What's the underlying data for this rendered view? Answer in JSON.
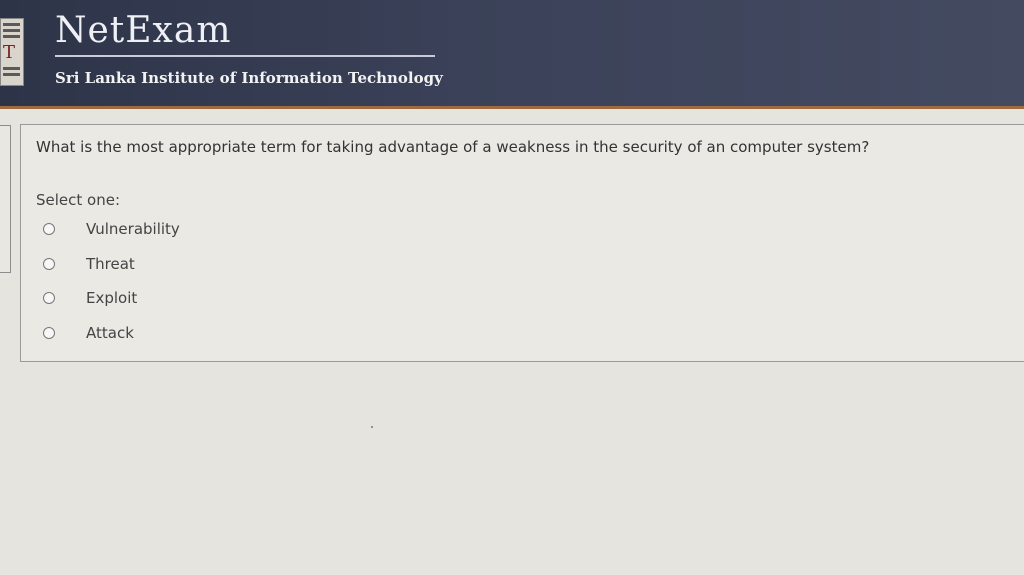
{
  "header": {
    "brand": "NetExam",
    "subtitle": "Sri Lanka Institute of Information Technology",
    "logo_letter": "T"
  },
  "question": {
    "text": "What is the most appropriate term for taking advantage of a weakness in the security of an computer system?",
    "prompt": "Select one:",
    "options": [
      {
        "label": "Vulnerability",
        "selected": false
      },
      {
        "label": "Threat",
        "selected": false
      },
      {
        "label": "Exploit",
        "selected": false
      },
      {
        "label": "Attack",
        "selected": false
      }
    ]
  },
  "colors": {
    "header_bg": "#3a4158",
    "header_accent": "#a06a3e",
    "page_bg": "#e6e4df"
  }
}
